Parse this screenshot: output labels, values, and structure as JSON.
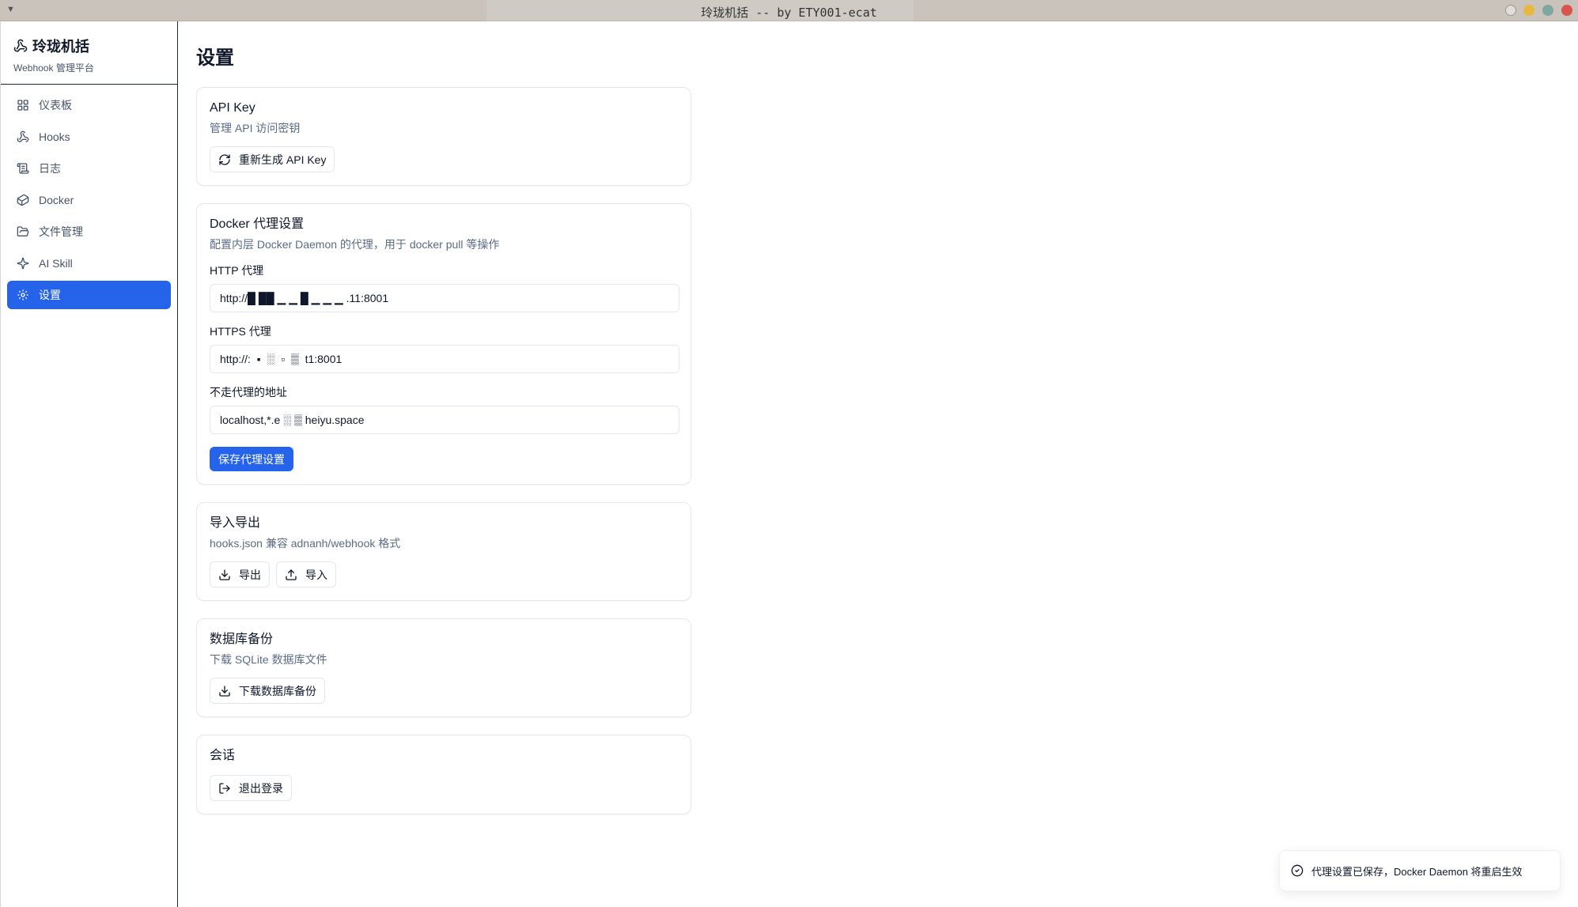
{
  "window": {
    "title": "玲珑机括 -- by ETY001-ecat",
    "menu_glyph": "▼"
  },
  "brand": {
    "name": "玲珑机括",
    "subtitle": "Webhook 管理平台",
    "icon": "webhook-icon"
  },
  "sidebar": {
    "items": [
      {
        "label": "仪表板",
        "icon": "dashboard-icon"
      },
      {
        "label": "Hooks",
        "icon": "webhook-icon"
      },
      {
        "label": "日志",
        "icon": "scroll-icon"
      },
      {
        "label": "Docker",
        "icon": "container-icon"
      },
      {
        "label": "文件管理",
        "icon": "folder-icon"
      },
      {
        "label": "AI Skill",
        "icon": "sparkles-icon"
      },
      {
        "label": "设置",
        "icon": "gear-icon",
        "active": true
      }
    ]
  },
  "page": {
    "title": "设置"
  },
  "api_key": {
    "title": "API Key",
    "desc": "管理 API 访问密钥",
    "regenerate_label": "重新生成 API Key"
  },
  "docker_proxy": {
    "title": "Docker 代理设置",
    "desc": "配置内层 Docker Daemon 的代理，用于 docker pull 等操作",
    "http_label": "HTTP 代理",
    "http_value": "http://█ ██ ▁ ▁ █ ▁ ▁ ▁ .11:8001",
    "https_label": "HTTPS 代理",
    "https_value": "http://:  ▪  ░  ▫  ▒  t1:8001",
    "no_proxy_label": "不走代理的地址",
    "no_proxy_value": "localhost,*.e ░ ▒ heiyu.space",
    "save_label": "保存代理设置"
  },
  "import_export": {
    "title": "导入导出",
    "desc": "hooks.json 兼容 adnanh/webhook 格式",
    "export_label": "导出",
    "import_label": "导入"
  },
  "db_backup": {
    "title": "数据库备份",
    "desc": "下载 SQLite 数据库文件",
    "download_label": "下载数据库备份"
  },
  "session": {
    "title": "会话",
    "logout_label": "退出登录"
  },
  "toast": {
    "message": "代理设置已保存，Docker Daemon 将重启生效",
    "icon": "check-circle-icon"
  },
  "colors": {
    "accent": "#2563eb",
    "muted_text": "#5b6b85"
  }
}
